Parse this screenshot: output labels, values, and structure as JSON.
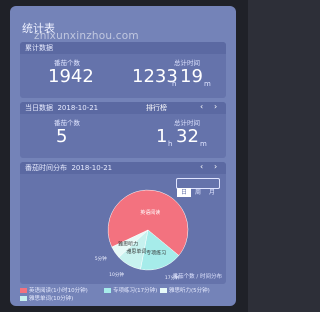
{
  "app": {
    "title": "统计表",
    "watermark": "zhixunxinzhou.com"
  },
  "total": {
    "title": "累计数据",
    "count_label": "番茄个数",
    "count_value": "1942",
    "time_label": "总计时间",
    "time_hours": "1233",
    "time_hours_unit": "h",
    "time_minutes": "19",
    "time_minutes_unit": "m"
  },
  "daily": {
    "title": "当日数据",
    "date": "2018-10-21",
    "sort_label": "排行榜",
    "prev_icon": "chevron-left-icon",
    "next_icon": "chevron-right-icon",
    "count_label": "番茄个数",
    "count_value": "5",
    "time_label": "总计时间",
    "time_hours": "1",
    "time_hours_unit": "h",
    "time_minutes": "32",
    "time_minutes_unit": "m"
  },
  "distribution": {
    "title": "番茄时间分布",
    "date": "2018-10-21",
    "tabs": [
      "日",
      "周",
      "月"
    ],
    "selected_tab": "日",
    "footer": "番茄个数 / 时间分布"
  },
  "chart_data": {
    "type": "pie",
    "title": "",
    "slices": [
      {
        "name": "英语阅读",
        "value": 68,
        "time": "1小时10分钟",
        "color": "#f3727f"
      },
      {
        "name": "专项练习",
        "value": 17,
        "time": "17分钟",
        "color": "#a6ecea"
      },
      {
        "name": "雅思单词",
        "value": 10,
        "time": "10分钟",
        "color": "#c7f2ef"
      },
      {
        "name": "雅思听力",
        "value": 5,
        "time": "5分钟",
        "color": "#e7faf8"
      }
    ]
  },
  "legend": {
    "items": [
      {
        "label": "英语阅读(1小时10分钟)",
        "color": "#f3727f"
      },
      {
        "label": "专项练习(17分钟)",
        "color": "#a6ecea"
      },
      {
        "label": "雅思听力(5分钟)",
        "color": "#e7faf8"
      },
      {
        "label": "雅思单词(10分钟)",
        "color": "#c7f2ef"
      }
    ]
  }
}
